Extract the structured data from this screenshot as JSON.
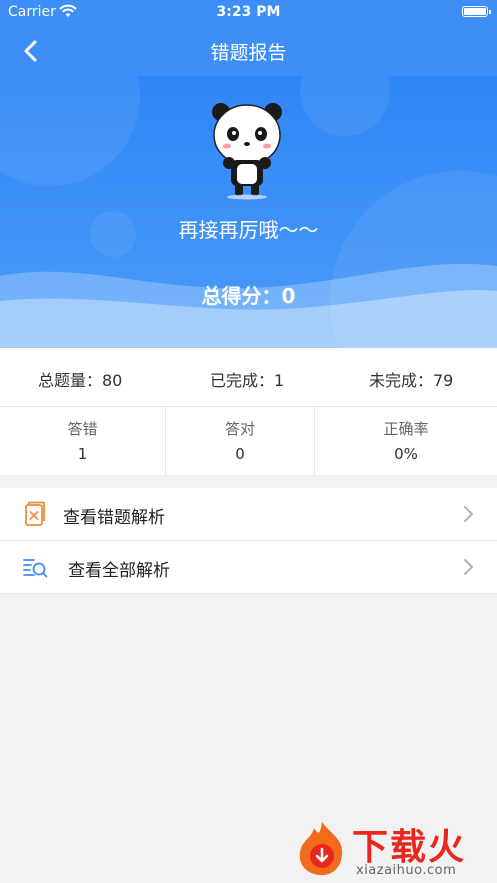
{
  "status_bar": {
    "carrier": "Carrier",
    "time": "3:23 PM",
    "wifi_icon": "wifi-icon",
    "battery_icon": "battery-icon"
  },
  "nav": {
    "title": "错题报告",
    "back_icon": "chevron-left-icon"
  },
  "hero": {
    "mascot": "panda-icon",
    "slogan": "再接再厉哦～～",
    "score_text": "总得分：0"
  },
  "summary": {
    "total": "总题量：80",
    "done": "已完成：1",
    "undone": "未完成：79"
  },
  "stats": [
    {
      "label": "答错",
      "value": "1"
    },
    {
      "label": "答对",
      "value": "0"
    },
    {
      "label": "正确率",
      "value": "0%"
    }
  ],
  "menu": [
    {
      "label": "查看错题解析",
      "icon": "wrong-answer-book-icon"
    },
    {
      "label": "查看全部解析",
      "icon": "search-list-icon"
    }
  ],
  "watermark": {
    "text": "下载火",
    "sub": "xiazaihuo.com"
  },
  "colors": {
    "primary": "#3e8ef7",
    "orange_icon": "#f08a3c",
    "blue_icon": "#3e8ef7",
    "watermark_red": "#e8281e"
  }
}
